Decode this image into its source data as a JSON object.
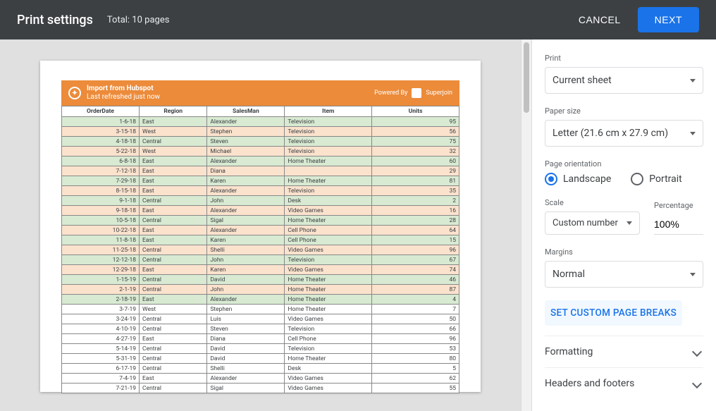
{
  "header": {
    "title": "Print settings",
    "total": "Total: 10 pages",
    "cancel": "CANCEL",
    "next": "NEXT"
  },
  "sidebar": {
    "print_label": "Print",
    "print_value": "Current sheet",
    "paper_label": "Paper size",
    "paper_value": "Letter (21.6 cm x 27.9 cm)",
    "orientation_label": "Page orientation",
    "orientation_landscape": "Landscape",
    "orientation_portrait": "Portrait",
    "scale_label": "Scale",
    "scale_value": "Custom number",
    "percentage_label": "Percentage",
    "percentage_value": "100%",
    "margins_label": "Margins",
    "margins_value": "Normal",
    "page_breaks": "SET CUSTOM PAGE BREAKS",
    "formatting": "Formatting",
    "headers_footers": "Headers and footers"
  },
  "chart_data": {
    "type": "table",
    "banner": {
      "line1": "Import from Hubspot",
      "line2": "Last refreshed just now",
      "powered_by": "Powered By",
      "brand": "Superjoin"
    },
    "columns": [
      "OrderDate",
      "Region",
      "SalesMan",
      "Item",
      "Units"
    ],
    "rows": [
      {
        "stripe": "g",
        "cells": [
          "1-6-18",
          "East",
          "Alexander",
          "Television",
          "95"
        ]
      },
      {
        "stripe": "o",
        "cells": [
          "3-15-18",
          "West",
          "Stephen",
          "Television",
          "56"
        ]
      },
      {
        "stripe": "g",
        "cells": [
          "4-18-18",
          "Central",
          "Steven",
          "Television",
          "75"
        ]
      },
      {
        "stripe": "o",
        "cells": [
          "5-22-18",
          "West",
          "Michael",
          "Television",
          "32"
        ]
      },
      {
        "stripe": "g",
        "cells": [
          "6-8-18",
          "East",
          "Alexander",
          "Home Theater",
          "60"
        ]
      },
      {
        "stripe": "o",
        "cells": [
          "7-12-18",
          "East",
          "Diana",
          "",
          "29"
        ]
      },
      {
        "stripe": "g",
        "cells": [
          "7-29-18",
          "East",
          "Karen",
          "Home Theater",
          "81"
        ]
      },
      {
        "stripe": "o",
        "cells": [
          "8-15-18",
          "East",
          "Alexander",
          "Television",
          "35"
        ]
      },
      {
        "stripe": "g",
        "cells": [
          "9-1-18",
          "Central",
          "John",
          "Desk",
          "2"
        ]
      },
      {
        "stripe": "o",
        "cells": [
          "9-18-18",
          "East",
          "Alexander",
          "Video Games",
          "16"
        ]
      },
      {
        "stripe": "g",
        "cells": [
          "10-5-18",
          "Central",
          "Sigal",
          "Home Theater",
          "28"
        ]
      },
      {
        "stripe": "o",
        "cells": [
          "10-22-18",
          "East",
          "Alexander",
          "Cell Phone",
          "64"
        ]
      },
      {
        "stripe": "g",
        "cells": [
          "11-8-18",
          "East",
          "Karen",
          "Cell Phone",
          "15"
        ]
      },
      {
        "stripe": "o",
        "cells": [
          "11-25-18",
          "Central",
          "Shelli",
          "Video Games",
          "96"
        ]
      },
      {
        "stripe": "g",
        "cells": [
          "12-12-18",
          "Central",
          "John",
          "Television",
          "67"
        ]
      },
      {
        "stripe": "o",
        "cells": [
          "12-29-18",
          "East",
          "Karen",
          "Video Games",
          "74"
        ]
      },
      {
        "stripe": "g",
        "cells": [
          "1-15-19",
          "Central",
          "David",
          "Home Theater",
          "46"
        ]
      },
      {
        "stripe": "o",
        "cells": [
          "2-1-19",
          "Central",
          "John",
          "Home Theater",
          "87"
        ]
      },
      {
        "stripe": "g",
        "cells": [
          "2-18-19",
          "East",
          "Alexander",
          "Home Theater",
          "4"
        ]
      },
      {
        "stripe": "w",
        "cells": [
          "3-7-19",
          "West",
          "Stephen",
          "Home Theater",
          "7"
        ]
      },
      {
        "stripe": "w",
        "cells": [
          "3-24-19",
          "Central",
          "Luis",
          "Video Games",
          "50"
        ]
      },
      {
        "stripe": "w",
        "cells": [
          "4-10-19",
          "Central",
          "Steven",
          "Television",
          "66"
        ]
      },
      {
        "stripe": "w",
        "cells": [
          "4-27-19",
          "East",
          "Diana",
          "Cell Phone",
          "96"
        ]
      },
      {
        "stripe": "w",
        "cells": [
          "5-14-19",
          "Central",
          "David",
          "Television",
          "53"
        ]
      },
      {
        "stripe": "w",
        "cells": [
          "5-31-19",
          "Central",
          "David",
          "Home Theater",
          "80"
        ]
      },
      {
        "stripe": "w",
        "cells": [
          "6-17-19",
          "Central",
          "Shelli",
          "Desk",
          "5"
        ]
      },
      {
        "stripe": "w",
        "cells": [
          "7-4-19",
          "East",
          "Alexander",
          "Video Games",
          "62"
        ]
      },
      {
        "stripe": "w",
        "cells": [
          "7-21-19",
          "Central",
          "Sigal",
          "Video Games",
          "55"
        ]
      }
    ]
  }
}
